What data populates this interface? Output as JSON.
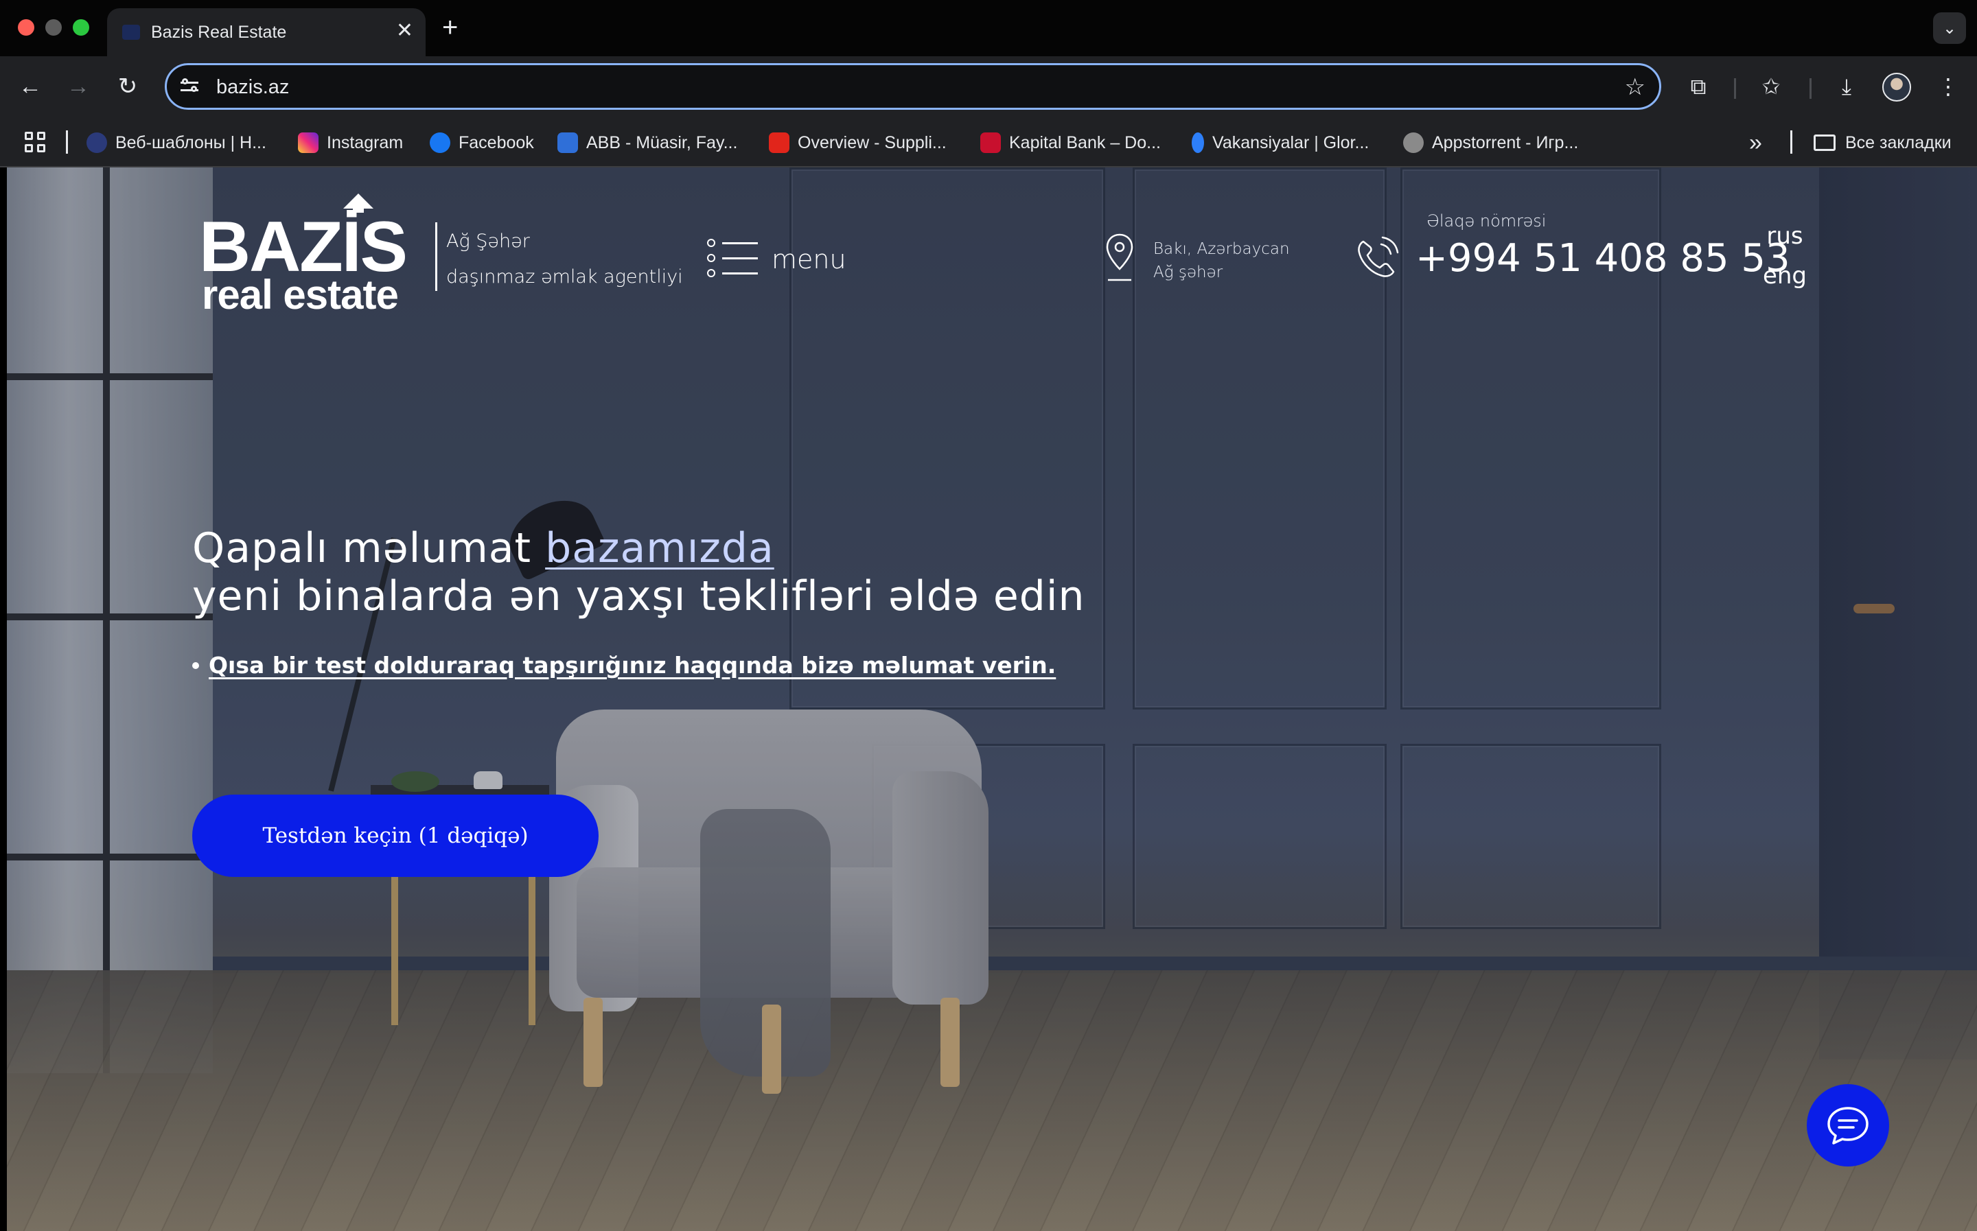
{
  "browser": {
    "tab_title": "Bazis Real Estate",
    "url": "bazis.az",
    "bookmarks": [
      {
        "label": "Веб-шаблоны | Н...",
        "icon": "globe-icon",
        "color": "#2b3a7a"
      },
      {
        "label": "Instagram",
        "icon": "instagram-icon",
        "color": "#d6249f"
      },
      {
        "label": "Facebook",
        "icon": "facebook-icon",
        "color": "#1877f2"
      },
      {
        "label": "ABB - Müasir, Fay...",
        "icon": "abb-icon",
        "color": "#2f6fd8"
      },
      {
        "label": "Overview - Suppli...",
        "icon": "overview-icon",
        "color": "#e1251b"
      },
      {
        "label": "Kapital Bank – Do...",
        "icon": "kapital-icon",
        "color": "#c8102e"
      },
      {
        "label": "Vakansiyalar | Glor...",
        "icon": "vakansiyalar-icon",
        "color": "#2d7ff9"
      },
      {
        "label": "Appstorrent - Игр...",
        "icon": "appstorrent-icon",
        "color": "#8a8a8a"
      }
    ],
    "all_bookmarks": "Все закладки"
  },
  "site": {
    "logo_main": "BAZİS",
    "logo_sub": "real estate",
    "tagline_line1": "Ağ Şəhər",
    "tagline_line2": "daşınmaz əmlak agentliyi",
    "menu_label": "menu",
    "location_line1": "Bakı, Azərbaycan",
    "location_line2": "Ağ şəhər",
    "phone_label": "Əlaqə nömrəsi",
    "phone_number": "+994 51 408 85 53",
    "lang_rus": "rus",
    "lang_eng": "eng",
    "hero_line1_prefix": "Qapalı məlumat ",
    "hero_line1_link": "bazamızda",
    "hero_line2": "yeni binalarda ən yaxşı təklifləri əldə edin",
    "hero_bullet": "Qısa bir test dolduraraq tapşırığınız haqqında bizə məlumat verin.",
    "cta_label": "Testdən keçin (1 dəqiqə)",
    "accent_color": "#0a1ee8"
  }
}
